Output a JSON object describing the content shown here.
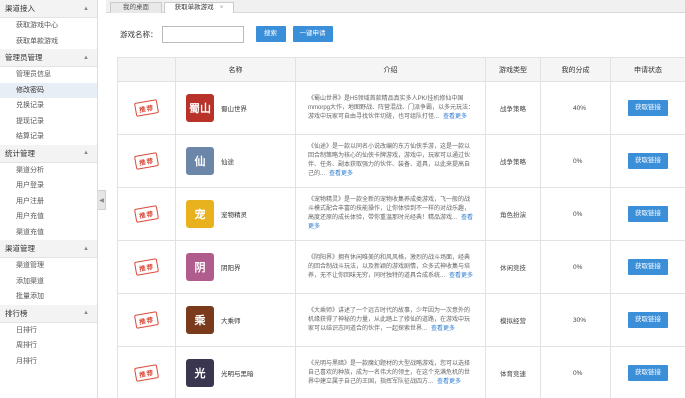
{
  "sidebar": {
    "sections": [
      {
        "title": "渠道接入",
        "items": [
          "获取游戏中心",
          "获取单款游戏"
        ]
      },
      {
        "title": "管理员管理",
        "items": [
          "管理员信息",
          "修改密码",
          "兑换记录",
          "提现记录",
          "结算记录"
        ]
      },
      {
        "title": "统计管理",
        "items": [
          "渠道分析",
          "用户登录",
          "用户注册",
          "用户充值",
          "渠道充值"
        ]
      },
      {
        "title": "渠道管理",
        "items": [
          "渠道管理",
          "添加渠道",
          "批量添加"
        ]
      },
      {
        "title": "排行榜",
        "items": [
          "日排行",
          "周排行",
          "月排行"
        ]
      }
    ],
    "active_item": "修改密码"
  },
  "tabs": [
    {
      "label": "我的桌面"
    },
    {
      "label": "获取单款游戏",
      "close": "×"
    }
  ],
  "search": {
    "label": "游戏名称：",
    "value": "",
    "placeholder": "",
    "search_button": "搜索",
    "apply_all_button": "一键申请"
  },
  "table": {
    "headers": [
      "",
      "名称",
      "介绍",
      "游戏类型",
      "我的分成",
      "申请状态"
    ],
    "rows": [
      {
        "stamp": "推荐",
        "name": "蜀山世界",
        "icon": "shushan-game-icon",
        "icon_color": "#b8322a",
        "icon_text": "蜀山",
        "intro": "《蜀山世界》是H5领域首款精品真实多人PK/挂机修仙中国mmorpg大作，地图野战、阵营混战、门派争霸，以多元玩法：游戏中玩家可自由寻找伙伴切磋，也可组队打怪...",
        "more": "查看更多",
        "type": "战争策略",
        "share": "40%",
        "button": "获取链接"
      },
      {
        "stamp": "推荐",
        "name": "仙途",
        "icon": "xiantu-game-icon",
        "icon_color": "#6b86a8",
        "icon_text": "仙",
        "intro": "《仙途》是一款以同名小说改编的东方仙侠手游，这是一款以回合制策略为核心的仙侠卡牌游戏，游戏中，玩家可以通过伙伴、任务、副本获取强力的伙伴、装备、道具，以此来提高自己的...",
        "more": "查看更多",
        "type": "战争策略",
        "share": "0%",
        "button": "获取链接"
      },
      {
        "stamp": "推荐",
        "name": "宠物精灵",
        "icon": "pet-game-icon",
        "icon_color": "#e8b21e",
        "icon_text": "宠",
        "intro": "《宠物精灵》是一款全新的宠物收集养成类游戏，飞一般的战斗模式配合丰富的技能操作，让你体验到不一样的对战乐趣，高度还原的成长体验，带你重温那时光经典！精品游戏...",
        "more": "查看更多",
        "type": "角色扮演",
        "share": "0%",
        "button": "获取链接"
      },
      {
        "stamp": "推荐",
        "name": "阴阳界",
        "icon": "yinyang-game-icon",
        "icon_color": "#b05c8c",
        "icon_text": "阴",
        "intro": "《阴阳界》拥有休闲唯美的和风风格，激烈的战斗场面，经典的回合制战斗玩法，以及新颖的游戏剧情，众多式神收集与培养，无不让你回味无穷，同时独特的道具合成系统...",
        "more": "查看更多",
        "type": "休闲竞技",
        "share": "0%",
        "button": "获取链接"
      },
      {
        "stamp": "推荐",
        "name": "大乘师",
        "icon": "dachengshi-game-icon",
        "icon_color": "#7a3b1c",
        "icon_text": "乘",
        "intro": "《大乘师》讲述了一个远古时代的故事，少年因为一次意外的机缘获得了神秘的力量，从此踏上了修仙的道路，在游戏中玩家可以结识志同道合的伙伴，一起探索世界...",
        "more": "查看更多",
        "type": "模拟经营",
        "share": "30%",
        "button": "获取链接"
      },
      {
        "stamp": "推荐",
        "name": "光明与黑暗",
        "icon": "guangming-game-icon",
        "icon_color": "#3a3650",
        "icon_text": "光",
        "intro": "《光明与黑暗》是一款魔幻题材的大型战略游戏，您可以选择自己喜欢的种族，成为一名伟大的领主，在这个充满危机的世界中建立属于自己的王国，指挥军队征战四方...",
        "more": "查看更多",
        "type": "体育竞速",
        "share": "0%",
        "button": "获取链接"
      }
    ]
  }
}
